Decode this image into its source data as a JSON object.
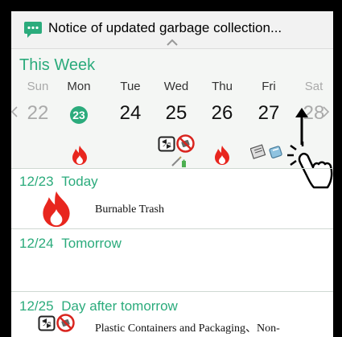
{
  "notice": {
    "text": "Notice of updated garbage collection...",
    "icon": "chat-bubble-icon"
  },
  "week": {
    "title": "This Week",
    "days": [
      {
        "name": "Sun",
        "date": "22"
      },
      {
        "name": "Mon",
        "date": "23"
      },
      {
        "name": "Tue",
        "date": "24"
      },
      {
        "name": "Wed",
        "date": "25"
      },
      {
        "name": "Thu",
        "date": "26"
      },
      {
        "name": "Fri",
        "date": "27"
      },
      {
        "name": "Sat",
        "date": "28"
      }
    ]
  },
  "schedule": [
    {
      "date": "12/23",
      "label": "Today",
      "item": "Burnable Trash"
    },
    {
      "date": "12/24",
      "label": "Tomorrow"
    },
    {
      "date": "12/25",
      "label": "Day after tomorrow",
      "item": "Plastic Containers and Packaging、Non-"
    }
  ],
  "colors": {
    "accent": "#2bab7c",
    "fire": "#e8261e",
    "no_sign": "#d9251f"
  }
}
